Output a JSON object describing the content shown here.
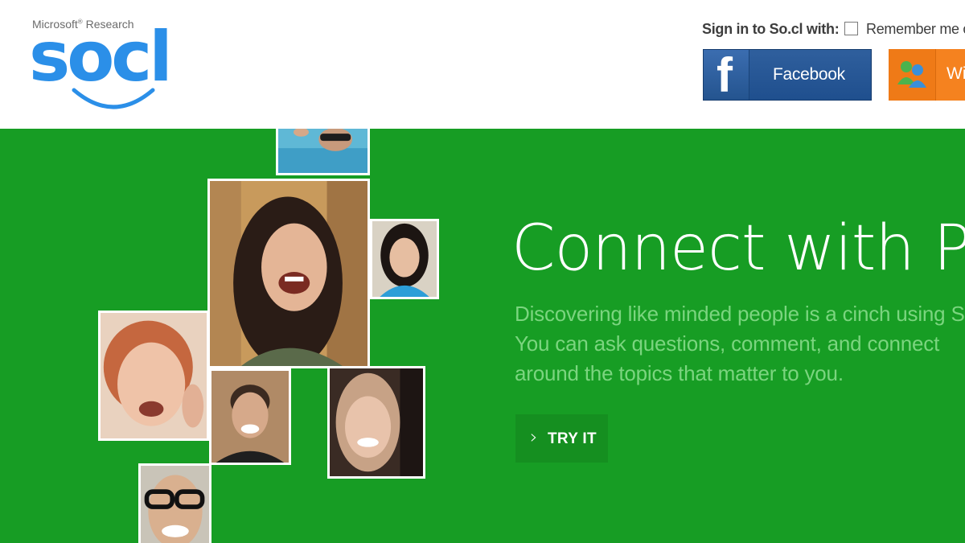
{
  "header": {
    "logo_top": "Microsoft",
    "logo_top_suffix": "Research",
    "logo_word": "socl",
    "signin_label": "Sign in to So.cl with:",
    "remember_label": "Remember me o",
    "facebook_label": "Facebook",
    "live_label": "Wi"
  },
  "hero": {
    "headline": "Connect with Peop",
    "description_lines": [
      "Discovering like minded people is a cinch using So",
      "You can ask questions, comment, and connect",
      "around the topics that matter to you."
    ],
    "try_label": "TRY IT",
    "try_icon": "chevron-right-icon"
  },
  "colors": {
    "hero_bg": "#179d24",
    "logo_blue": "#2b8fe8",
    "facebook_blue": "#2a5a98",
    "live_orange": "#f5821f",
    "desc_text": "#7bd57f"
  }
}
